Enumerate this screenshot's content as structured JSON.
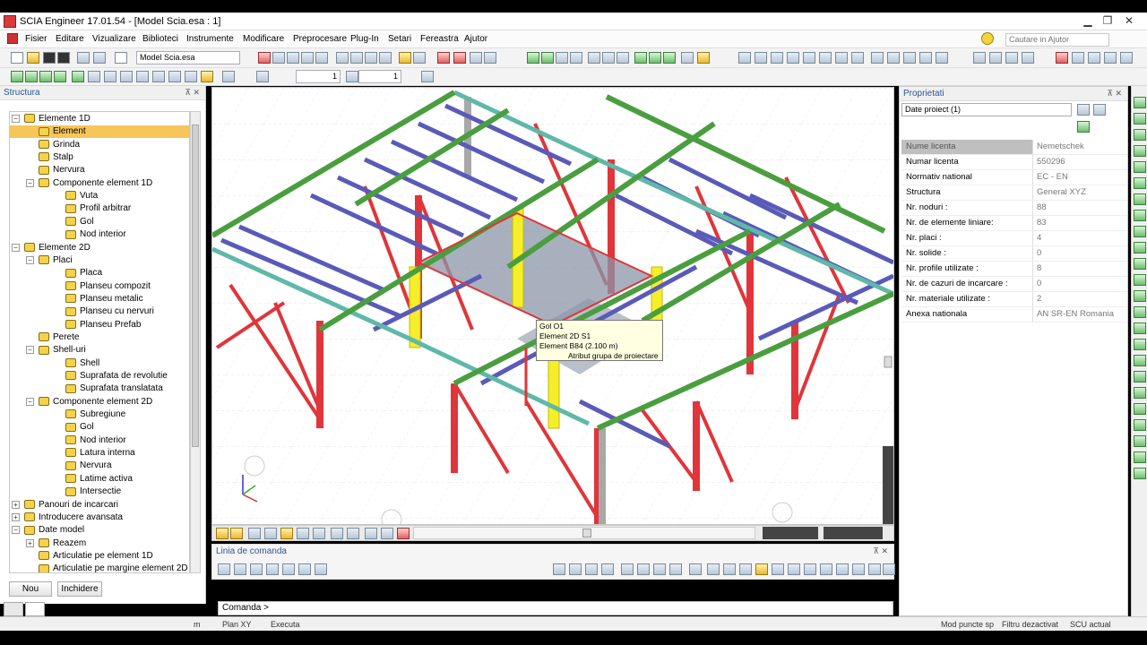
{
  "window": {
    "title": "SCIA Engineer 17.01.54 - [Model Scia.esa : 1]",
    "min": "▁",
    "restore": "❐",
    "close": "✕"
  },
  "menu": [
    "Fisier",
    "Editare",
    "Vizualizare",
    "Biblioteci",
    "Instrumente",
    "Modificare",
    "Preprocesare",
    "Plug-In",
    "Setari",
    "Fereastra",
    "Ajutor"
  ],
  "search": {
    "placeholder": "Cautare in Ajutor"
  },
  "toolbar": {
    "model_combo": "Model Scia.esa",
    "spin1": "1",
    "spin2": "1"
  },
  "structure_panel": {
    "title": "Structura",
    "pin": "⊼ ✕",
    "tree": [
      {
        "label": "Elemente 1D",
        "level": 0,
        "exp": "−"
      },
      {
        "label": "Element",
        "level": 1,
        "selected": true
      },
      {
        "label": "Grinda",
        "level": 1
      },
      {
        "label": "Stalp",
        "level": 1
      },
      {
        "label": "Nervura",
        "level": 1
      },
      {
        "label": "Componente element 1D",
        "level": 1,
        "exp": "−"
      },
      {
        "label": "Vuta",
        "level": 2
      },
      {
        "label": "Profil arbitrar",
        "level": 2
      },
      {
        "label": "Gol",
        "level": 2
      },
      {
        "label": "Nod interior",
        "level": 2
      },
      {
        "label": "Elemente 2D",
        "level": 0,
        "exp": "−"
      },
      {
        "label": "Placi",
        "level": 1,
        "exp": "−"
      },
      {
        "label": "Placa",
        "level": 2
      },
      {
        "label": "Planseu compozit",
        "level": 2
      },
      {
        "label": "Planseu metalic",
        "level": 2
      },
      {
        "label": "Planseu cu nervuri",
        "level": 2
      },
      {
        "label": "Planseu Prefab",
        "level": 2
      },
      {
        "label": "Perete",
        "level": 1
      },
      {
        "label": "Shell-uri",
        "level": 1,
        "exp": "−"
      },
      {
        "label": "Shell",
        "level": 2
      },
      {
        "label": "Suprafata de revolutie",
        "level": 2
      },
      {
        "label": "Suprafata translatata",
        "level": 2
      },
      {
        "label": "Componente element 2D",
        "level": 1,
        "exp": "−"
      },
      {
        "label": "Subregiune",
        "level": 2
      },
      {
        "label": "Gol",
        "level": 2
      },
      {
        "label": "Nod interior",
        "level": 2
      },
      {
        "label": "Latura interna",
        "level": 2
      },
      {
        "label": "Nervura",
        "level": 2
      },
      {
        "label": "Latime activa",
        "level": 2
      },
      {
        "label": "Intersectie",
        "level": 2
      },
      {
        "label": "Panouri de incarcari",
        "level": 0,
        "exp": "+"
      },
      {
        "label": "Introducere avansata",
        "level": 0,
        "exp": "+"
      },
      {
        "label": "Date model",
        "level": 0,
        "exp": "−"
      },
      {
        "label": "Reazem",
        "level": 1,
        "exp": "+"
      },
      {
        "label": "Articulatie pe element 1D",
        "level": 1
      },
      {
        "label": "Articulatie pe margine element 2D",
        "level": 1
      }
    ],
    "btn_new": "Nou",
    "btn_close": "Inchidere"
  },
  "tooltip": {
    "line1": "Gol O1",
    "line2": "Element 2D S1",
    "line3": "Element B84 (2.100 m)",
    "line4": "Atribut grupa de proiectare"
  },
  "cmd_panel": {
    "title": "Linia de comanda",
    "pin": "⊼ ✕",
    "prompt": "Comanda >"
  },
  "properties": {
    "title": "Proprietati",
    "pin": "⊼ ✕",
    "combo": "Date proiect (1)",
    "rows": [
      {
        "k": "Nume licenta",
        "v": "Nemetschek"
      },
      {
        "k": "Numar licenta",
        "v": "550296"
      },
      {
        "k": "Normativ national",
        "v": "EC - EN"
      },
      {
        "k": "Structura",
        "v": "General XYZ"
      },
      {
        "k": "Nr. noduri :",
        "v": "88"
      },
      {
        "k": "Nr. de elemente liniare:",
        "v": "83"
      },
      {
        "k": "Nr. placi :",
        "v": "4"
      },
      {
        "k": "Nr. solide :",
        "v": "0"
      },
      {
        "k": "Nr. profile utilizate :",
        "v": "8"
      },
      {
        "k": "Nr. de cazuri de incarcare :",
        "v": "0"
      },
      {
        "k": "Nr. materiale utilizate :",
        "v": "2"
      },
      {
        "k": "Anexa nationala",
        "v": "AN SR-EN Romania"
      }
    ]
  },
  "status": {
    "unit": "m",
    "plane": "Plan XY",
    "mode": "Executa",
    "snap": "Mod puncte sp",
    "filter": "Filtru dezactivat",
    "ucs": "SCU actual"
  },
  "colors": {
    "green": "#4a9e3f",
    "teal": "#5fb8a8",
    "purple": "#5a5ab8",
    "red": "#e0353a",
    "yellow": "#f5ee2a",
    "grey": "#a8a8a8"
  }
}
